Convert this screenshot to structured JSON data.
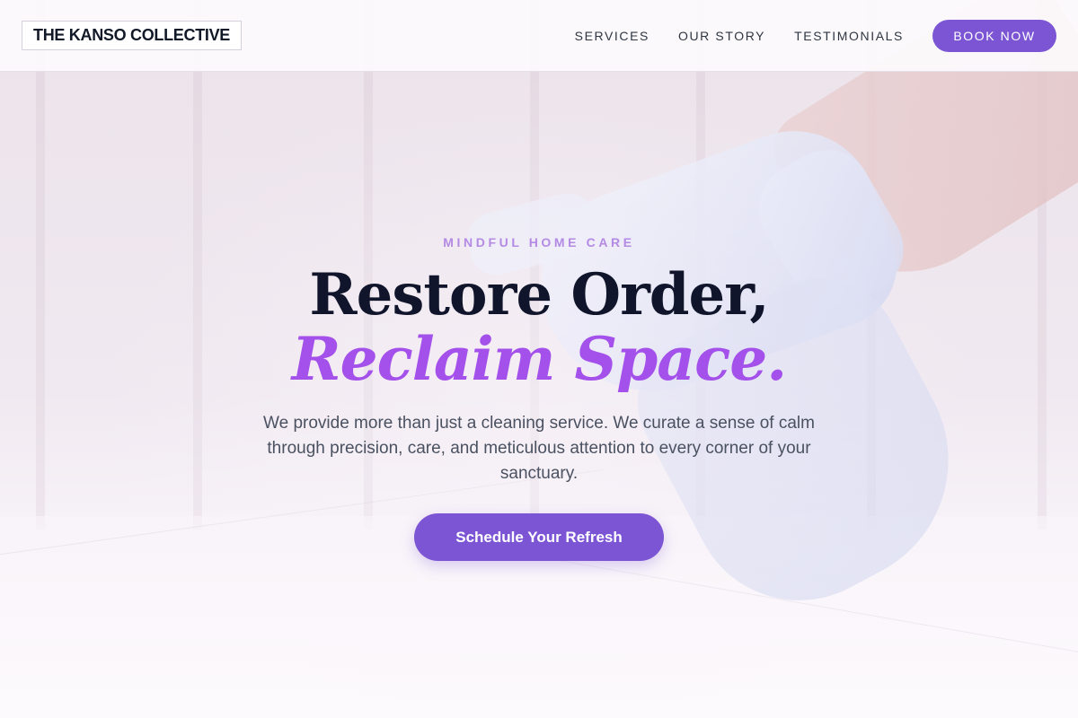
{
  "header": {
    "logo_text": "THE KANSO COLLECTIVE",
    "nav": [
      {
        "label": "SERVICES"
      },
      {
        "label": "OUR STORY"
      },
      {
        "label": "TESTIMONIALS"
      }
    ],
    "cta_label": "BOOK NOW"
  },
  "hero": {
    "eyebrow": "MINDFUL HOME CARE",
    "headline_line1": "Restore Order,",
    "headline_line2": "Reclaim Space.",
    "description": "We provide more than just a cleaning service. We curate a sense of calm through precision, care, and meticulous attention to every corner of your sanctuary.",
    "cta_label": "Schedule Your Refresh",
    "background_image": "gloved-hand-spray-bottle-photo"
  },
  "colors": {
    "accent": "#7c55d4",
    "headline_accent": "#a450ea",
    "eyebrow": "#b48ae4",
    "headline_dark": "#10152b",
    "body_text": "#4a5160"
  }
}
